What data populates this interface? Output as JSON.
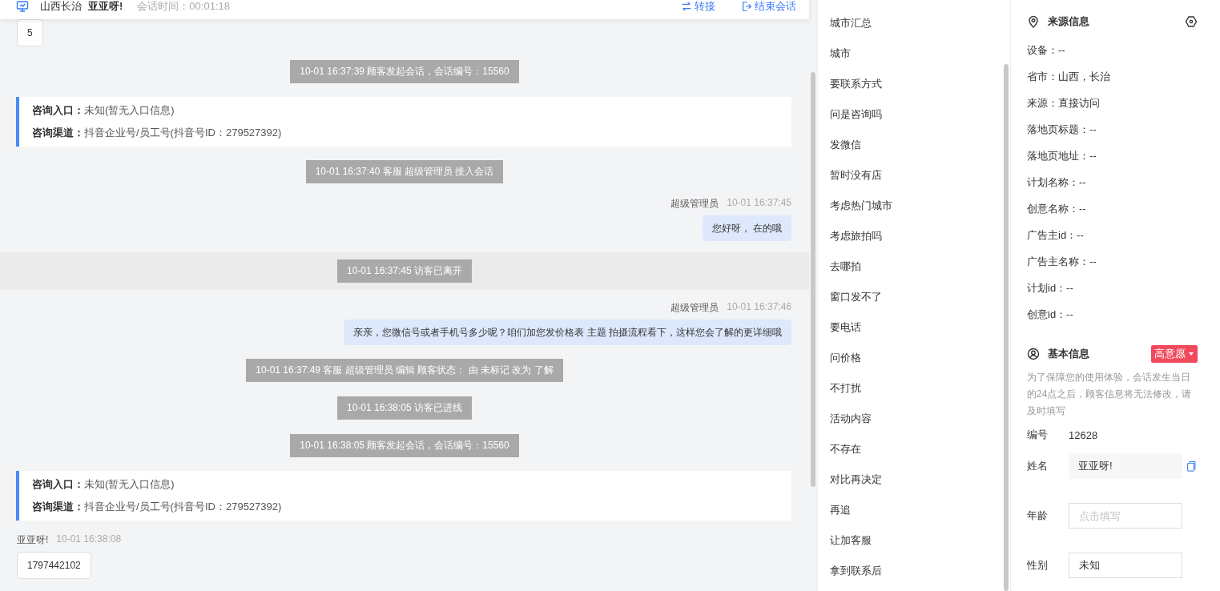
{
  "header": {
    "location": "山西长治",
    "visitor": "亚亚呀!",
    "duration_label": "会话时间：",
    "duration": "00:01:18",
    "actions": [
      {
        "kind": "transfer",
        "label": "转接"
      },
      {
        "kind": "end",
        "label": "结束会话"
      }
    ]
  },
  "messages": [
    {
      "kind": "visitor",
      "text": "5"
    },
    {
      "kind": "system",
      "text": "10-01 16:37:39 顾客发起会话，会话编号：15560"
    },
    {
      "kind": "info",
      "lines": [
        {
          "label": "咨询入口：",
          "value": "未知(暂无入口信息)"
        },
        {
          "label": "咨询渠道：",
          "value": "抖音企业号/员工号(抖音号ID：279527392)"
        }
      ]
    },
    {
      "kind": "system",
      "text": "10-01 16:37:40 客服 超级管理员 接入会话"
    },
    {
      "kind": "agent",
      "name": "超级管理员",
      "time": "10-01 16:37:45",
      "text": "您好呀， 在的哦"
    },
    {
      "kind": "leave",
      "text": "10-01 16:37:45 访客已离开"
    },
    {
      "kind": "agent",
      "name": "超级管理员",
      "time": "10-01 16:37:46",
      "text": "亲亲，您微信号或者手机号多少呢？咱们加您发价格表 主题 拍摄流程看下，这样您会了解的更详细哦"
    },
    {
      "kind": "system",
      "text": "10-01 16:37:49 客服 超级管理员 编辑 顾客状态： 由 未标记 改为 了解"
    },
    {
      "kind": "system",
      "text": "10-01 16:38:05 访客已进线"
    },
    {
      "kind": "system",
      "text": "10-01 16:38:05 顾客发起会话，会话编号：15560"
    },
    {
      "kind": "info",
      "lines": [
        {
          "label": "咨询入口：",
          "value": "未知(暂无入口信息)"
        },
        {
          "label": "咨询渠道：",
          "value": "抖音企业号/员工号(抖音号ID：279527392)"
        }
      ]
    },
    {
      "kind": "visitor",
      "name": "亚亚呀!",
      "time": "10-01 16:38:08",
      "text": "1797442102"
    }
  ],
  "quick_replies": [
    "城市汇总",
    "城市",
    "要联系方式",
    "问是咨询吗",
    "发微信",
    "暂时没有店",
    "考虑热门城市",
    "考虑旅拍吗",
    "去哪拍",
    "窗口发不了",
    "要电话",
    "问价格",
    "不打扰",
    "活动内容",
    "不存在",
    "对比再决定",
    "再追",
    "让加客服",
    "拿到联系后"
  ],
  "source_info": {
    "title": "来源信息",
    "fields": [
      "设备：--",
      "省市：山西，长治",
      "来源：直接访问",
      "落地页标题：--",
      "落地页地址：--",
      "计划名称：--",
      "创意名称：--",
      "广告主id：--",
      "广告主名称：--",
      "计划id：--",
      "创意id：--"
    ]
  },
  "basic_info": {
    "title": "基本信息",
    "intent_tag": "高意愿",
    "notice": "为了保障您的使用体验，会话发生当日的24点之后，顾客信息将无法修改，请及时填写",
    "id_label": "编号",
    "id_value": "12628",
    "fields": [
      {
        "kind": "locked",
        "label": "姓名",
        "value": "亚亚呀!"
      },
      {
        "kind": "input",
        "label": "年龄",
        "placeholder": "点击填写"
      },
      {
        "kind": "input",
        "label": "性别",
        "value": "未知"
      }
    ]
  }
}
